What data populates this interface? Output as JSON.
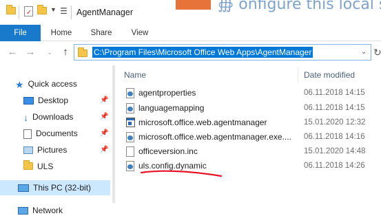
{
  "window": {
    "title": "AgentManager",
    "background_overlay_text": "∰ onfigure this local se"
  },
  "ribbon": {
    "tabs": [
      {
        "label": "File",
        "active": true
      },
      {
        "label": "Home"
      },
      {
        "label": "Share"
      },
      {
        "label": "View"
      }
    ]
  },
  "address_bar": {
    "path": "C:\\Program Files\\Microsoft Office Web Apps\\AgentManager",
    "selected": true
  },
  "nav_pane": {
    "quick_access_label": "Quick access",
    "items": [
      {
        "label": "Desktop",
        "icon": "desktop-icon",
        "pinned": true
      },
      {
        "label": "Downloads",
        "icon": "downloads-icon",
        "pinned": true
      },
      {
        "label": "Documents",
        "icon": "documents-icon",
        "pinned": true
      },
      {
        "label": "Pictures",
        "icon": "pictures-icon",
        "pinned": true
      },
      {
        "label": "ULS",
        "icon": "folder-icon",
        "pinned": false
      }
    ],
    "this_pc_label": "This PC (32-bit)",
    "network_label": "Network"
  },
  "file_list": {
    "columns": {
      "name": "Name",
      "date": "Date modified"
    },
    "files": [
      {
        "name": "agentproperties",
        "date": "06.11.2018 14:15",
        "icon": "config-file-icon"
      },
      {
        "name": "languagemapping",
        "date": "06.11.2018 14:15",
        "icon": "config-file-icon"
      },
      {
        "name": "microsoft.office.web.agentmanager",
        "date": "15.01.2020 12:32",
        "icon": "application-icon"
      },
      {
        "name": "microsoft.office.web.agentmanager.exe....",
        "date": "06.11.2018 14:16",
        "icon": "config-file-icon"
      },
      {
        "name": "officeversion.inc",
        "date": "15.01.2020 14:48",
        "icon": "blank-file-icon"
      },
      {
        "name": "uls.config.dynamic",
        "date": "06.11.2018 14:26",
        "icon": "config-file-icon"
      }
    ]
  },
  "colors": {
    "accent": "#0078d7",
    "file_tab": "#1979ca",
    "selection": "#cce8ff",
    "annotation_underline": "#e81123"
  }
}
